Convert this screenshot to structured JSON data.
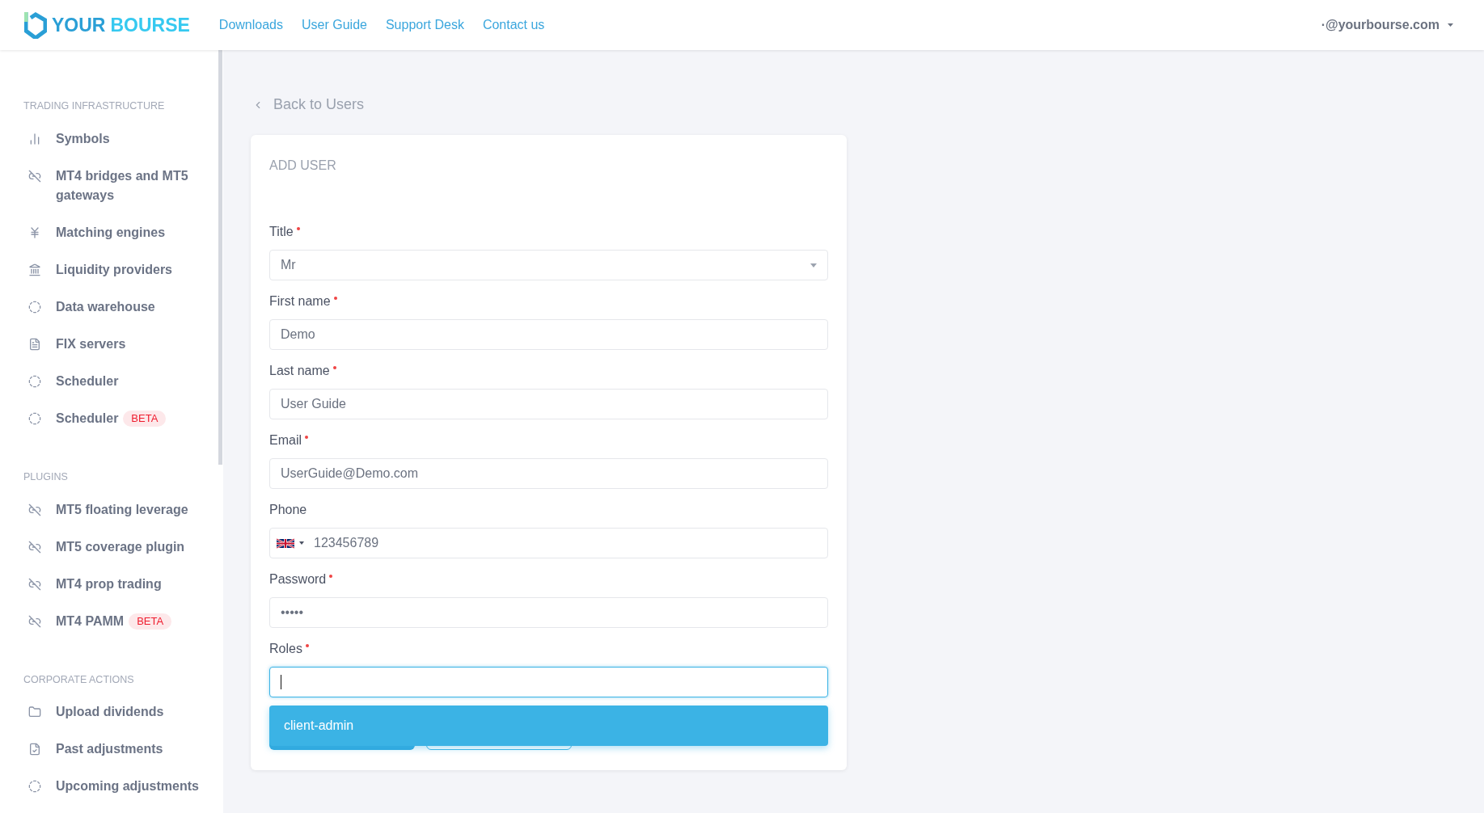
{
  "header": {
    "logo": [
      "YOUR",
      "BOURSE"
    ],
    "nav": [
      "Downloads",
      "User Guide",
      "Support Desk",
      "Contact us"
    ],
    "account": "·@yourbourse.com"
  },
  "sidebar": {
    "sections": [
      {
        "title": "TRADING INFRASTRUCTURE",
        "items": [
          {
            "label": "Symbols",
            "kind": "chart"
          },
          {
            "label": "MT4 bridges and MT5 gateways",
            "kind": "link"
          },
          {
            "label": "Matching engines",
            "kind": "yen"
          },
          {
            "label": "Liquidity providers",
            "kind": "bank"
          },
          {
            "label": "Data warehouse",
            "kind": "ring"
          },
          {
            "label": "FIX servers",
            "kind": "doc"
          },
          {
            "label": "Scheduler",
            "kind": "ring"
          },
          {
            "label": "Scheduler",
            "kind": "ring",
            "badge": "BETA"
          }
        ]
      },
      {
        "title": "PLUGINS",
        "items": [
          {
            "label": "MT5 floating leverage",
            "kind": "link"
          },
          {
            "label": "MT5 coverage plugin",
            "kind": "link"
          },
          {
            "label": "MT4 prop trading",
            "kind": "link"
          },
          {
            "label": "MT4 PAMM",
            "kind": "link",
            "badge": "BETA"
          }
        ]
      },
      {
        "title": "CORPORATE ACTIONS",
        "items": [
          {
            "label": "Upload dividends",
            "kind": "folder"
          },
          {
            "label": "Past adjustments",
            "kind": "check"
          },
          {
            "label": "Upcoming adjustments",
            "kind": "ring"
          }
        ]
      }
    ]
  },
  "back_link": "Back to Users",
  "form": {
    "title": "ADD USER",
    "fields": [
      {
        "label": "Title",
        "kind": "select",
        "required": true,
        "value": "Mr",
        "focused": false
      },
      {
        "label": "First name",
        "kind": "text",
        "required": true,
        "value": "Demo",
        "focused": false
      },
      {
        "label": "Last name",
        "kind": "text",
        "required": true,
        "value": "User Guide",
        "focused": false
      },
      {
        "label": "Email",
        "kind": "text",
        "required": true,
        "value": "UserGuide@Demo.com",
        "focused": false
      },
      {
        "label": "Phone",
        "kind": "phone",
        "required": false,
        "value": "123456789",
        "focused": false
      },
      {
        "label": "Password",
        "kind": "text",
        "required": true,
        "value": "•••••",
        "focused": false
      },
      {
        "label": "Roles",
        "kind": "combobox",
        "required": true,
        "focused": true
      }
    ],
    "role_options": [
      {
        "label": "client-admin",
        "selected": true
      }
    ]
  }
}
